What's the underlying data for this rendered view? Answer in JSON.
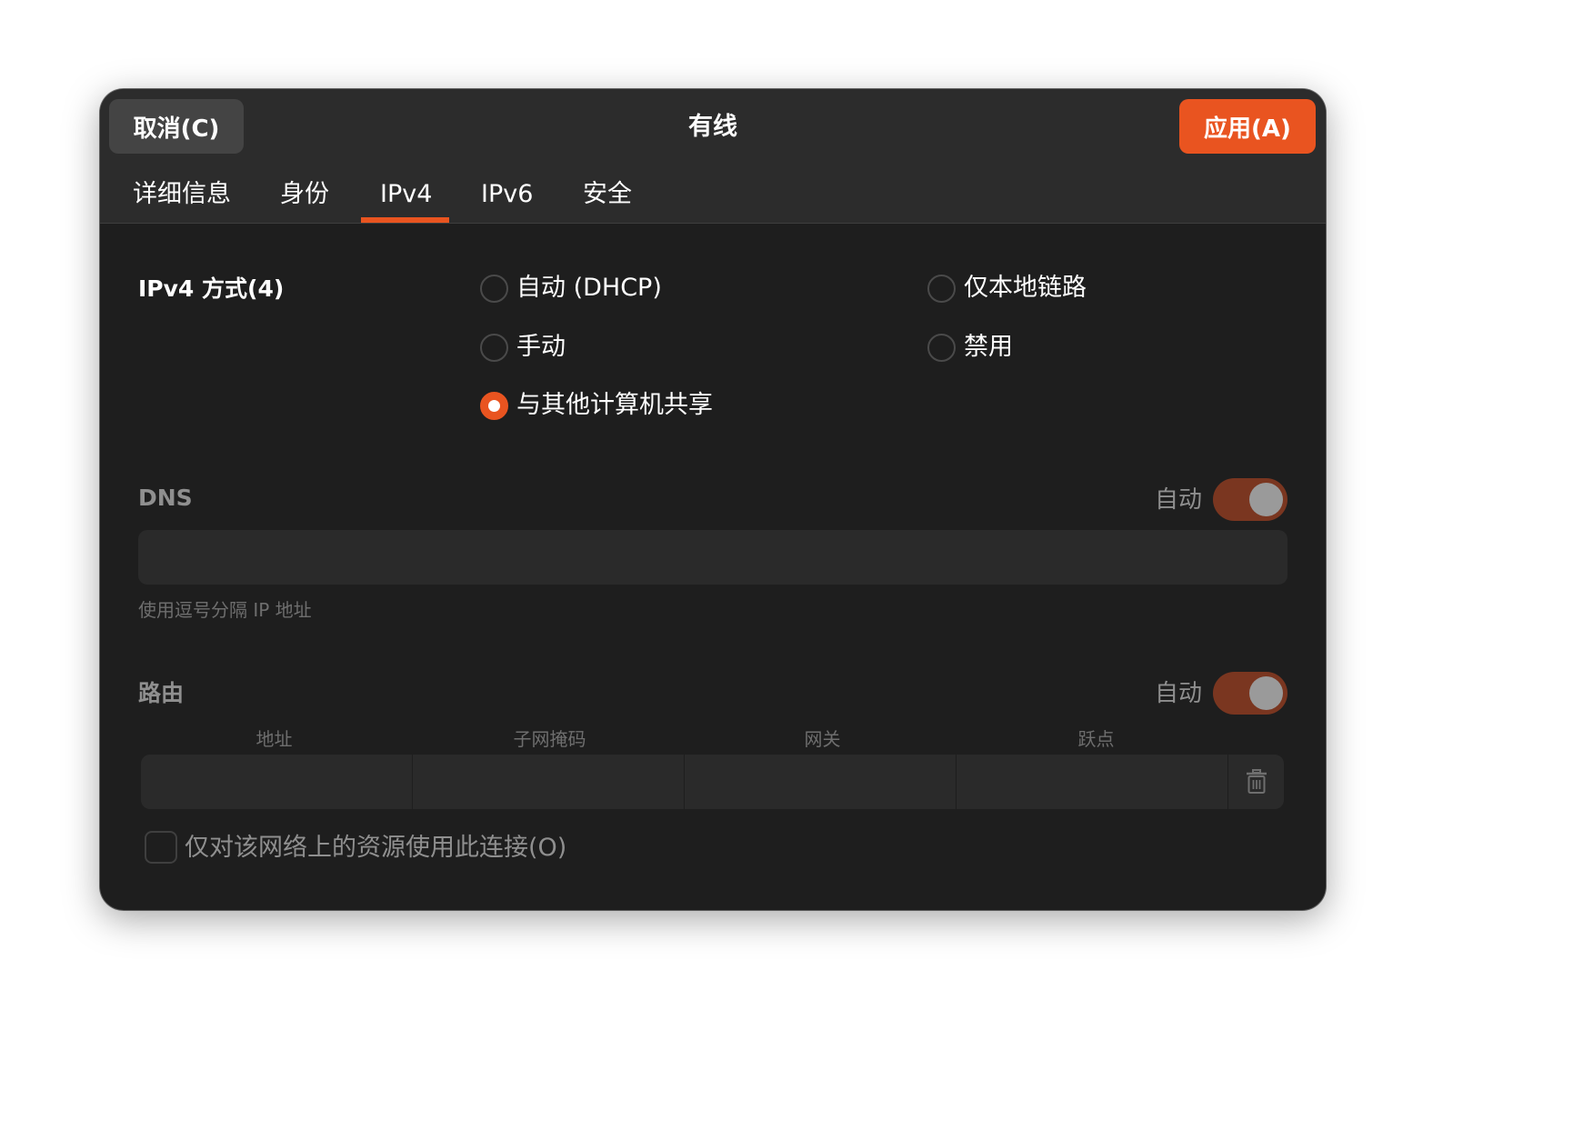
{
  "window": {
    "title": "有线"
  },
  "header": {
    "cancel_label": "取消(C)",
    "apply_label": "应用(A)"
  },
  "tabs": [
    {
      "label": "详细信息"
    },
    {
      "label": "身份"
    },
    {
      "label": "IPv4",
      "selected": true
    },
    {
      "label": "IPv6"
    },
    {
      "label": "安全"
    }
  ],
  "ipv4_method": {
    "label": "IPv4 方式(4)",
    "options": [
      {
        "label": "自动 (DHCP)",
        "checked": false
      },
      {
        "label": "仅本地链路",
        "checked": false
      },
      {
        "label": "手动",
        "checked": false
      },
      {
        "label": "禁用",
        "checked": false
      },
      {
        "label": "与其他计算机共享",
        "checked": true
      }
    ]
  },
  "dns": {
    "label": "DNS",
    "auto_label": "自动",
    "auto_enabled": true,
    "value": "",
    "hint": "使用逗号分隔 IP 地址"
  },
  "routes": {
    "label": "路由",
    "auto_label": "自动",
    "auto_enabled": true,
    "columns": [
      "地址",
      "子网掩码",
      "网关",
      "跃点"
    ],
    "row": {
      "address": "",
      "netmask": "",
      "gateway": "",
      "metric": ""
    },
    "delete_icon": "trash-icon"
  },
  "only_local": {
    "label": "仅对该网络上的资源使用此连接(O)",
    "checked": false
  },
  "colors": {
    "accent": "#e95420",
    "window_bg": "#1e1e1e",
    "header_bg": "#2c2c2c"
  }
}
